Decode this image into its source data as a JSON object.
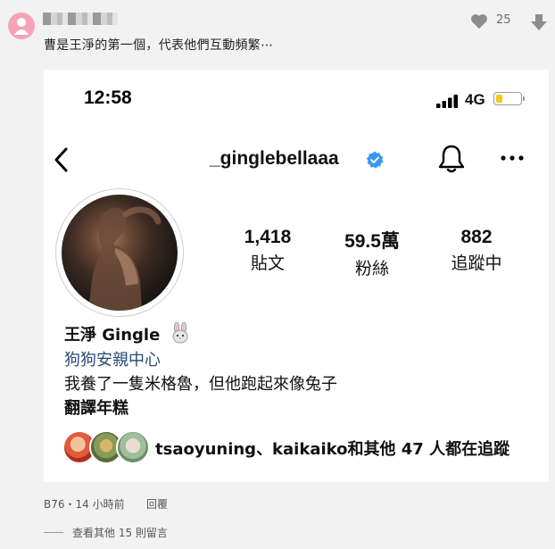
{
  "comment": {
    "like_count": "25",
    "text": "曹是王淨的第一個，代表他們互動頻繁⋯",
    "meta": "B76・14 小時前",
    "reply_label": "回覆",
    "view_more": "查看其他 15 則留言"
  },
  "profile": {
    "status_time": "12:58",
    "network": "4G",
    "battery_level": 0.25,
    "username": "_ginglebellaaa",
    "posts_count": "1,418",
    "posts_label": "貼文",
    "followers_count": "59.5萬",
    "followers_label": "粉絲",
    "following_count": "882",
    "following_label": "追蹤中",
    "display_name": "王淨 Gingle",
    "category": "狗狗安親中心",
    "bio": "我養了一隻米格魯，但他跑起來像兔子",
    "bio_line2": "翻譯年糕",
    "followed_by": "tsaoyuning、kaikaiko和其他 47 人都在追蹤"
  },
  "colors": {
    "avatar": "#f6a2b8",
    "verified": "#3897f0",
    "battery": "#f2cb1b",
    "category_link": "#2c4a74"
  },
  "icons": [
    "heart-icon",
    "downvote-icon",
    "back-icon",
    "verified-icon",
    "bell-icon",
    "more-icon",
    "rabbit-icon",
    "signal-icon",
    "battery-icon"
  ]
}
